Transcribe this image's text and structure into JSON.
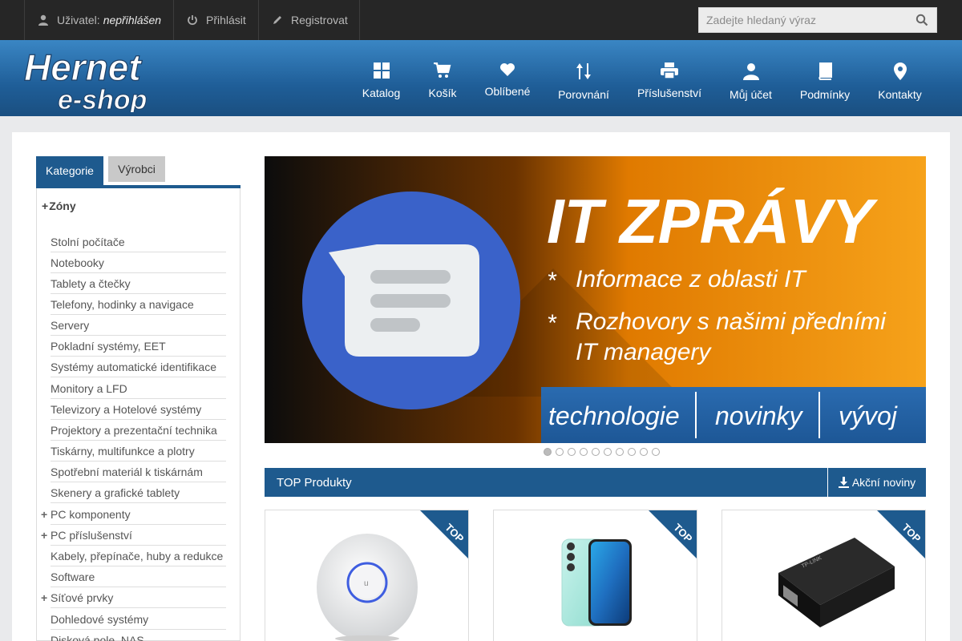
{
  "topbar": {
    "user_label": "Uživatel:",
    "user_value": "nepřihlášen",
    "login": "Přihlásit",
    "register": "Registrovat",
    "search_placeholder": "Zadejte hledaný výraz"
  },
  "logo": {
    "line1": "Hernet",
    "line2": "e-shop"
  },
  "nav": [
    {
      "label": "Katalog",
      "icon": "grid-icon"
    },
    {
      "label": "Košík",
      "icon": "cart-icon"
    },
    {
      "label": "Oblíbené",
      "icon": "heart-icon"
    },
    {
      "label": "Porovnání",
      "icon": "sort-arrows-icon"
    },
    {
      "label": "Příslušenství",
      "icon": "printer-icon"
    },
    {
      "label": "Můj účet",
      "icon": "user-icon"
    },
    {
      "label": "Podmínky",
      "icon": "book-icon"
    },
    {
      "label": "Kontakty",
      "icon": "map-marker-icon"
    }
  ],
  "sidebar": {
    "tabs": [
      "Kategorie",
      "Výrobci"
    ],
    "zony": "Zóny",
    "categories": [
      "Stolní počítače",
      "Notebooky",
      "Tablety a čtečky",
      "Telefony, hodinky a navigace",
      "Servery",
      "Pokladní systémy, EET",
      "Systémy automatické identifikace",
      "Monitory a LFD",
      "Televizory a Hotelové systémy",
      "Projektory a prezentační technika",
      "Tiskárny, multifunkce a plotry",
      "Spotřební materiál k tiskárnám",
      "Skenery a grafické tablety",
      "PC komponenty",
      "PC příslušenství",
      "Kabely, přepínače, huby a redukce",
      "Software",
      "Síťové prvky",
      "Dohledové systémy",
      "Disková pole, NAS"
    ]
  },
  "banner": {
    "title": "IT ZPRÁVY",
    "bullet1": "Informace z oblasti IT",
    "bullet2a": "Rozhovory s našimi předními",
    "bullet2b": "IT managery",
    "foot": [
      "technologie",
      "novinky",
      "vývoj"
    ],
    "slides": 10,
    "active_slide": 1
  },
  "top_products": {
    "title": "TOP Produkty",
    "action": "Akční noviny",
    "badge": "TOP"
  },
  "colors": {
    "brand_blue": "#1e5a8e",
    "banner_orange": "#f39200"
  }
}
